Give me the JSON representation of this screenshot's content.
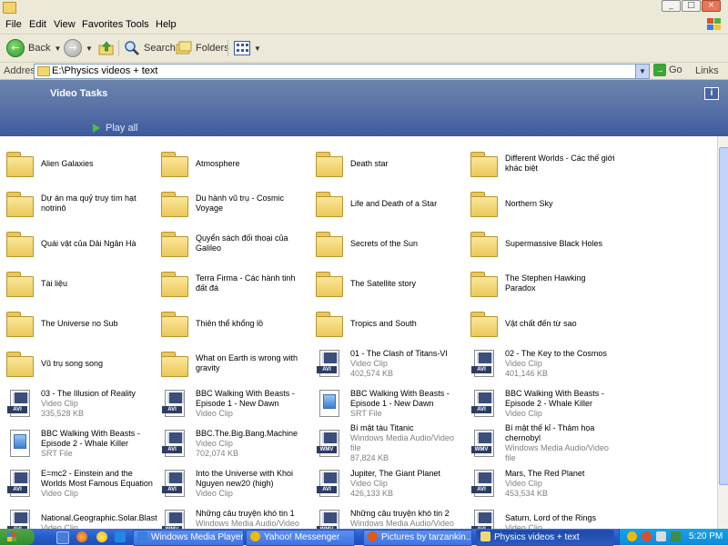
{
  "menu": [
    "File",
    "Edit",
    "View",
    "Favorites",
    "Tools",
    "Help"
  ],
  "toolbar": {
    "back": "Back",
    "search": "Search",
    "folders": "Folders"
  },
  "address": {
    "label": "Address",
    "path": "E:\\Physics videos + text",
    "go": "Go",
    "links": "Links"
  },
  "tasks": {
    "title": "Video Tasks",
    "play_all": "Play all"
  },
  "items": [
    {
      "name": "Alien Galaxies",
      "kind": "folder"
    },
    {
      "name": "Atmosphere",
      "kind": "folder"
    },
    {
      "name": "Death star",
      "kind": "folder"
    },
    {
      "name": "Different Worlds - Các thế giới khác biệt",
      "kind": "folder"
    },
    {
      "name": "Dự án ma quỷ truy tìm hạt notrinô",
      "kind": "folder"
    },
    {
      "name": "Du hành vũ trụ - Cosmic Voyage",
      "kind": "folder"
    },
    {
      "name": "Life and Death of a Star",
      "kind": "folder"
    },
    {
      "name": "Northern Sky",
      "kind": "folder"
    },
    {
      "name": "Quái vật của Dải Ngân Hà",
      "kind": "folder"
    },
    {
      "name": "Quyển sách đối thoại của Galileo",
      "kind": "folder"
    },
    {
      "name": "Secrets of the Sun",
      "kind": "folder"
    },
    {
      "name": "Supermassive Black Holes",
      "kind": "folder"
    },
    {
      "name": "Tài liệu",
      "kind": "folder"
    },
    {
      "name": "Terra Firma - Các hành tinh đất đá",
      "kind": "folder"
    },
    {
      "name": "The Satellite story",
      "kind": "folder"
    },
    {
      "name": "The Stephen Hawking Paradox",
      "kind": "folder"
    },
    {
      "name": "The Universe no Sub",
      "kind": "folder"
    },
    {
      "name": "Thiên thể khổng lồ",
      "kind": "folder"
    },
    {
      "name": "Tropics and South",
      "kind": "folder"
    },
    {
      "name": "Vật chất đến từ sao",
      "kind": "folder"
    },
    {
      "name": "Vũ trụ song song",
      "kind": "folder"
    },
    {
      "name": "What on Earth is wrong with gravity",
      "kind": "folder"
    },
    {
      "name": "01 - The Clash of Titans-VI",
      "kind": "avi",
      "type": "Video Clip",
      "size": "402,574 KB"
    },
    {
      "name": "02 - The Key to the Cosmos",
      "kind": "avi",
      "type": "Video Clip",
      "size": "401,146 KB"
    },
    {
      "name": "03 - The Illusion of Reality",
      "kind": "avi",
      "type": "Video Clip",
      "size": "335,528 KB"
    },
    {
      "name": "BBC Walking With Beasts - Episode 1 - New Dawn",
      "kind": "avi",
      "type": "Video Clip",
      "size": ""
    },
    {
      "name": "BBC Walking With Beasts - Episode 1 - New Dawn",
      "kind": "srt",
      "type": "SRT File",
      "size": ""
    },
    {
      "name": "BBC Walking With Beasts - Episode 2 - Whale Killer",
      "kind": "avi",
      "type": "Video Clip",
      "size": ""
    },
    {
      "name": "BBC Walking With Beasts - Episode 2 - Whale Killer",
      "kind": "srt",
      "type": "SRT File",
      "size": ""
    },
    {
      "name": "BBC.The.Big.Bang.Machine",
      "kind": "avi",
      "type": "Video Clip",
      "size": "702,074 KB"
    },
    {
      "name": "Bí mật tàu Titanic",
      "kind": "wmv",
      "type": "Windows Media Audio/Video file",
      "size": "87,824 KB"
    },
    {
      "name": "Bí mật thế kỉ - Thảm họa chernobyl",
      "kind": "wmv",
      "type": "Windows Media Audio/Video file",
      "size": ""
    },
    {
      "name": "E=mc2 - Einstein and the Worlds Most Famous Equation",
      "kind": "avi",
      "type": "Video Clip",
      "size": ""
    },
    {
      "name": "Into the Universe with Khoi Nguyen new20 (high)",
      "kind": "avi",
      "type": "Video Clip",
      "size": ""
    },
    {
      "name": "Jupiter, The Giant Planet",
      "kind": "avi",
      "type": "Video Clip",
      "size": "426,133 KB"
    },
    {
      "name": "Mars, The Red Planet",
      "kind": "avi",
      "type": "Video Clip",
      "size": "453,534 KB"
    },
    {
      "name": "National.Geographic.Solar.Blast",
      "kind": "avi",
      "type": "Video Clip",
      "size": ""
    },
    {
      "name": "Những câu truyện khó tin 1",
      "kind": "wmv",
      "type": "Windows Media Audio/Video file",
      "size": ""
    },
    {
      "name": "Những câu truyện khó tin 2",
      "kind": "wmv",
      "type": "Windows Media Audio/Video file",
      "size": ""
    },
    {
      "name": "Saturn, Lord of the Rings",
      "kind": "avi",
      "type": "Video Clip",
      "size": ""
    }
  ],
  "taskbar": {
    "buttons": [
      "Windows Media Player",
      "Yahoo! Messenger",
      "Pictures by tarzankin...",
      "Physics videos + text"
    ],
    "clock": "5:20 PM"
  }
}
